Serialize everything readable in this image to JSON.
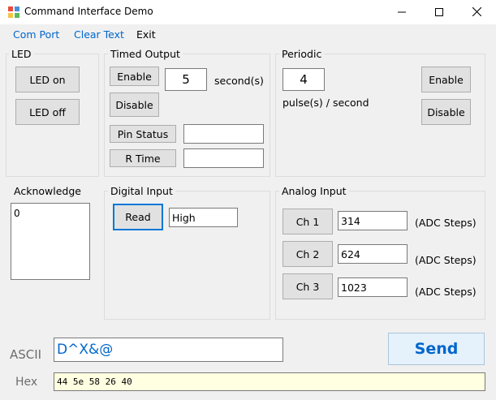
{
  "window": {
    "title": "Command Interface Demo"
  },
  "menu": {
    "items": [
      "Com Port",
      "Clear Text",
      "Exit"
    ]
  },
  "led": {
    "group_label": "LED",
    "on_label": "LED on",
    "off_label": "LED off"
  },
  "timed": {
    "group_label": "Timed Output",
    "enable_label": "Enable",
    "disable_label": "Disable",
    "seconds_value": "5",
    "seconds_unit": "second(s)",
    "pin_status_label": "Pin Status",
    "pin_status_value": "",
    "rtime_label": "R Time",
    "rtime_value": ""
  },
  "periodic": {
    "group_label": "Periodic",
    "rate_value": "4",
    "rate_unit": "pulse(s) / second",
    "enable_label": "Enable",
    "disable_label": "Disable"
  },
  "acknowledge": {
    "group_label": "Acknowledge",
    "value": "0"
  },
  "digital": {
    "group_label": "Digital Input",
    "read_label": "Read",
    "value": "High"
  },
  "analog": {
    "group_label": "Analog Input",
    "channels": [
      {
        "label": "Ch 1",
        "value": "314",
        "unit": "(ADC Steps)"
      },
      {
        "label": "Ch 2",
        "value": "624",
        "unit": "(ADC Steps)"
      },
      {
        "label": "Ch 3",
        "value": "1023",
        "unit": "(ADC Steps)"
      }
    ]
  },
  "send": {
    "ascii_label": "ASCII",
    "ascii_value": "D^X&@",
    "send_label": "Send",
    "hex_label": "Hex",
    "hex_value": "44 5e 58 26 40"
  },
  "colors": {
    "accent": "#0066cc",
    "hex_field_bg": "#ffffe1",
    "send_button_bg": "#e5f1fb"
  }
}
